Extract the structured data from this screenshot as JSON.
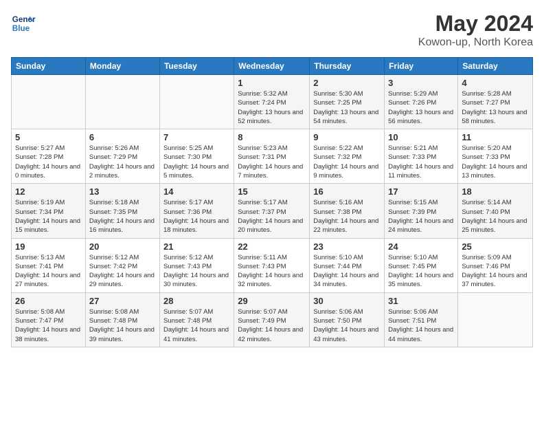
{
  "header": {
    "logo_line1": "General",
    "logo_line2": "Blue",
    "month_year": "May 2024",
    "location": "Kowon-up, North Korea"
  },
  "weekdays": [
    "Sunday",
    "Monday",
    "Tuesday",
    "Wednesday",
    "Thursday",
    "Friday",
    "Saturday"
  ],
  "weeks": [
    [
      {
        "day": "",
        "info": ""
      },
      {
        "day": "",
        "info": ""
      },
      {
        "day": "",
        "info": ""
      },
      {
        "day": "1",
        "info": "Sunrise: 5:32 AM\nSunset: 7:24 PM\nDaylight: 13 hours and 52 minutes."
      },
      {
        "day": "2",
        "info": "Sunrise: 5:30 AM\nSunset: 7:25 PM\nDaylight: 13 hours and 54 minutes."
      },
      {
        "day": "3",
        "info": "Sunrise: 5:29 AM\nSunset: 7:26 PM\nDaylight: 13 hours and 56 minutes."
      },
      {
        "day": "4",
        "info": "Sunrise: 5:28 AM\nSunset: 7:27 PM\nDaylight: 13 hours and 58 minutes."
      }
    ],
    [
      {
        "day": "5",
        "info": "Sunrise: 5:27 AM\nSunset: 7:28 PM\nDaylight: 14 hours and 0 minutes."
      },
      {
        "day": "6",
        "info": "Sunrise: 5:26 AM\nSunset: 7:29 PM\nDaylight: 14 hours and 2 minutes."
      },
      {
        "day": "7",
        "info": "Sunrise: 5:25 AM\nSunset: 7:30 PM\nDaylight: 14 hours and 5 minutes."
      },
      {
        "day": "8",
        "info": "Sunrise: 5:23 AM\nSunset: 7:31 PM\nDaylight: 14 hours and 7 minutes."
      },
      {
        "day": "9",
        "info": "Sunrise: 5:22 AM\nSunset: 7:32 PM\nDaylight: 14 hours and 9 minutes."
      },
      {
        "day": "10",
        "info": "Sunrise: 5:21 AM\nSunset: 7:33 PM\nDaylight: 14 hours and 11 minutes."
      },
      {
        "day": "11",
        "info": "Sunrise: 5:20 AM\nSunset: 7:33 PM\nDaylight: 14 hours and 13 minutes."
      }
    ],
    [
      {
        "day": "12",
        "info": "Sunrise: 5:19 AM\nSunset: 7:34 PM\nDaylight: 14 hours and 15 minutes."
      },
      {
        "day": "13",
        "info": "Sunrise: 5:18 AM\nSunset: 7:35 PM\nDaylight: 14 hours and 16 minutes."
      },
      {
        "day": "14",
        "info": "Sunrise: 5:17 AM\nSunset: 7:36 PM\nDaylight: 14 hours and 18 minutes."
      },
      {
        "day": "15",
        "info": "Sunrise: 5:17 AM\nSunset: 7:37 PM\nDaylight: 14 hours and 20 minutes."
      },
      {
        "day": "16",
        "info": "Sunrise: 5:16 AM\nSunset: 7:38 PM\nDaylight: 14 hours and 22 minutes."
      },
      {
        "day": "17",
        "info": "Sunrise: 5:15 AM\nSunset: 7:39 PM\nDaylight: 14 hours and 24 minutes."
      },
      {
        "day": "18",
        "info": "Sunrise: 5:14 AM\nSunset: 7:40 PM\nDaylight: 14 hours and 25 minutes."
      }
    ],
    [
      {
        "day": "19",
        "info": "Sunrise: 5:13 AM\nSunset: 7:41 PM\nDaylight: 14 hours and 27 minutes."
      },
      {
        "day": "20",
        "info": "Sunrise: 5:12 AM\nSunset: 7:42 PM\nDaylight: 14 hours and 29 minutes."
      },
      {
        "day": "21",
        "info": "Sunrise: 5:12 AM\nSunset: 7:43 PM\nDaylight: 14 hours and 30 minutes."
      },
      {
        "day": "22",
        "info": "Sunrise: 5:11 AM\nSunset: 7:43 PM\nDaylight: 14 hours and 32 minutes."
      },
      {
        "day": "23",
        "info": "Sunrise: 5:10 AM\nSunset: 7:44 PM\nDaylight: 14 hours and 34 minutes."
      },
      {
        "day": "24",
        "info": "Sunrise: 5:10 AM\nSunset: 7:45 PM\nDaylight: 14 hours and 35 minutes."
      },
      {
        "day": "25",
        "info": "Sunrise: 5:09 AM\nSunset: 7:46 PM\nDaylight: 14 hours and 37 minutes."
      }
    ],
    [
      {
        "day": "26",
        "info": "Sunrise: 5:08 AM\nSunset: 7:47 PM\nDaylight: 14 hours and 38 minutes."
      },
      {
        "day": "27",
        "info": "Sunrise: 5:08 AM\nSunset: 7:48 PM\nDaylight: 14 hours and 39 minutes."
      },
      {
        "day": "28",
        "info": "Sunrise: 5:07 AM\nSunset: 7:48 PM\nDaylight: 14 hours and 41 minutes."
      },
      {
        "day": "29",
        "info": "Sunrise: 5:07 AM\nSunset: 7:49 PM\nDaylight: 14 hours and 42 minutes."
      },
      {
        "day": "30",
        "info": "Sunrise: 5:06 AM\nSunset: 7:50 PM\nDaylight: 14 hours and 43 minutes."
      },
      {
        "day": "31",
        "info": "Sunrise: 5:06 AM\nSunset: 7:51 PM\nDaylight: 14 hours and 44 minutes."
      },
      {
        "day": "",
        "info": ""
      }
    ]
  ]
}
